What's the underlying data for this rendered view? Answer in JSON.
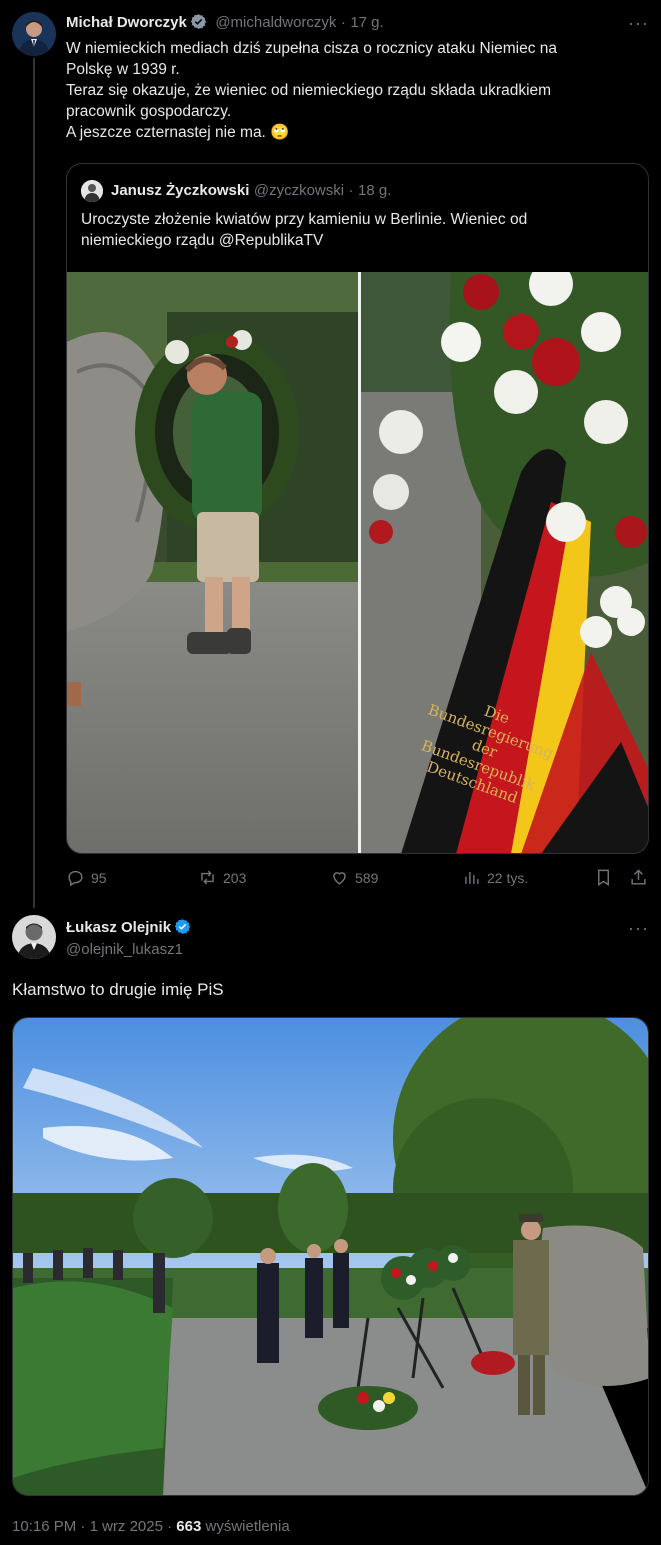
{
  "tweet1": {
    "author_name": "Michał Dworczyk",
    "handle": "@michaldworczyk",
    "separator": "·",
    "age": "17 g.",
    "lines": [
      "W niemieckich mediach dziś zupełna cisza o rocznicy ataku Niemiec na",
      "Polskę w 1939 r.",
      "Teraz się okazuje, że wieniec od niemieckiego rządu składa ukradkiem",
      "pracownik gospodarczy.",
      "A jeszcze czternastej nie ma. 🙄"
    ],
    "quote": {
      "author_name": "Janusz Życzkowski",
      "handle": "@zyczkowski",
      "separator": "·",
      "age": "18 g.",
      "lines": [
        "Uroczyste złożenie kwiatów przy kamieniu w Berlinie. Wieniec od",
        "niemieckiego rządu @RepublikaTV"
      ],
      "ribbon_text": [
        "Die",
        "Bundesregierung",
        "der",
        "Bundesrepublik",
        "Deutschland"
      ]
    },
    "stats": {
      "replies": "95",
      "reposts": "203",
      "likes": "589",
      "views": "22 tys."
    }
  },
  "tweet2": {
    "author_name": "Łukasz Olejnik",
    "handle": "@olejnik_lukasz1",
    "text": "Kłamstwo to drugie imię PiS",
    "footer": {
      "time": "10:16 PM",
      "separator1": "·",
      "date": "1 wrz 2025",
      "separator2": "·",
      "views_count": "663",
      "views_label": "wyświetlenia"
    }
  },
  "colors": {
    "background": "#000000",
    "text": "#e7e9ea",
    "muted": "#71767b",
    "verified": "#1d9bf0",
    "border": "#2f3336"
  },
  "icons": [
    "verified-badge-icon",
    "more-icon",
    "reply-icon",
    "repost-icon",
    "like-icon",
    "views-icon",
    "bookmark-icon",
    "share-icon"
  ]
}
